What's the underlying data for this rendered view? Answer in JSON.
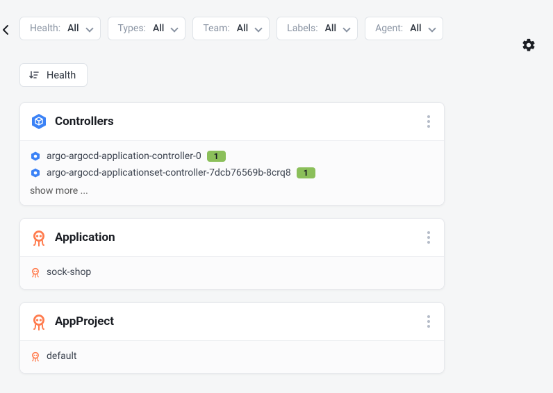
{
  "filters": [
    {
      "label": "Health:",
      "value": "All"
    },
    {
      "label": "Types:",
      "value": "All"
    },
    {
      "label": "Team:",
      "value": "All"
    },
    {
      "label": "Labels:",
      "value": "All"
    },
    {
      "label": "Agent:",
      "value": "All"
    }
  ],
  "sort": {
    "label": "Health"
  },
  "cards": {
    "controllers": {
      "title": "Controllers",
      "items": [
        {
          "name": "argo-argocd-application-controller-0",
          "badge": "1"
        },
        {
          "name": "argo-argocd-applicationset-controller-7dcb76569b-8crq8",
          "badge": "1"
        }
      ],
      "showMore": "show more ..."
    },
    "application": {
      "title": "Application",
      "items": [
        {
          "name": "sock-shop"
        }
      ]
    },
    "appproject": {
      "title": "AppProject",
      "items": [
        {
          "name": "default"
        }
      ]
    }
  }
}
